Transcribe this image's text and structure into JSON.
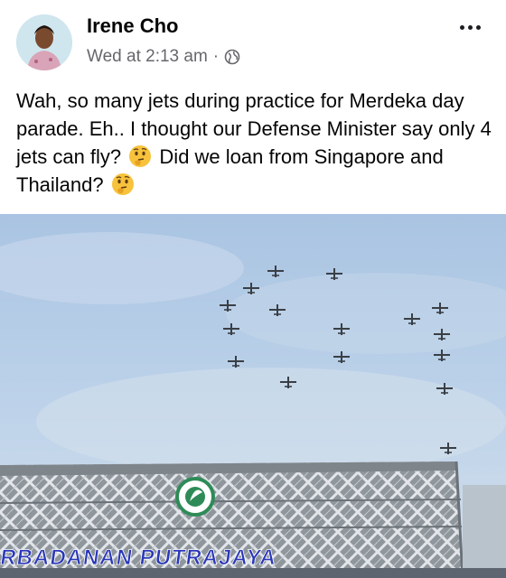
{
  "post": {
    "author": "Irene Cho",
    "timestamp": "Wed at 2:13 am",
    "separator": "·",
    "audience_icon": "globe-icon",
    "more_icon": "more-options-icon",
    "text_part1": "Wah, so many jets during practice for Merdeka day parade. Eh.. I thought our Defense Minister say only 4 jets can fly?",
    "text_part2": "Did we loan from Singapore and Thailand?",
    "emoji": "thinking-face-emoji"
  },
  "photo": {
    "building_sign": "PERBADANAN PUTRAJAYA",
    "logo_icon": "perbadanan-putrajaya-logo-icon",
    "jet_count": 19,
    "sky_color": "#b5cde6",
    "sign_color": "#2a37b8"
  }
}
